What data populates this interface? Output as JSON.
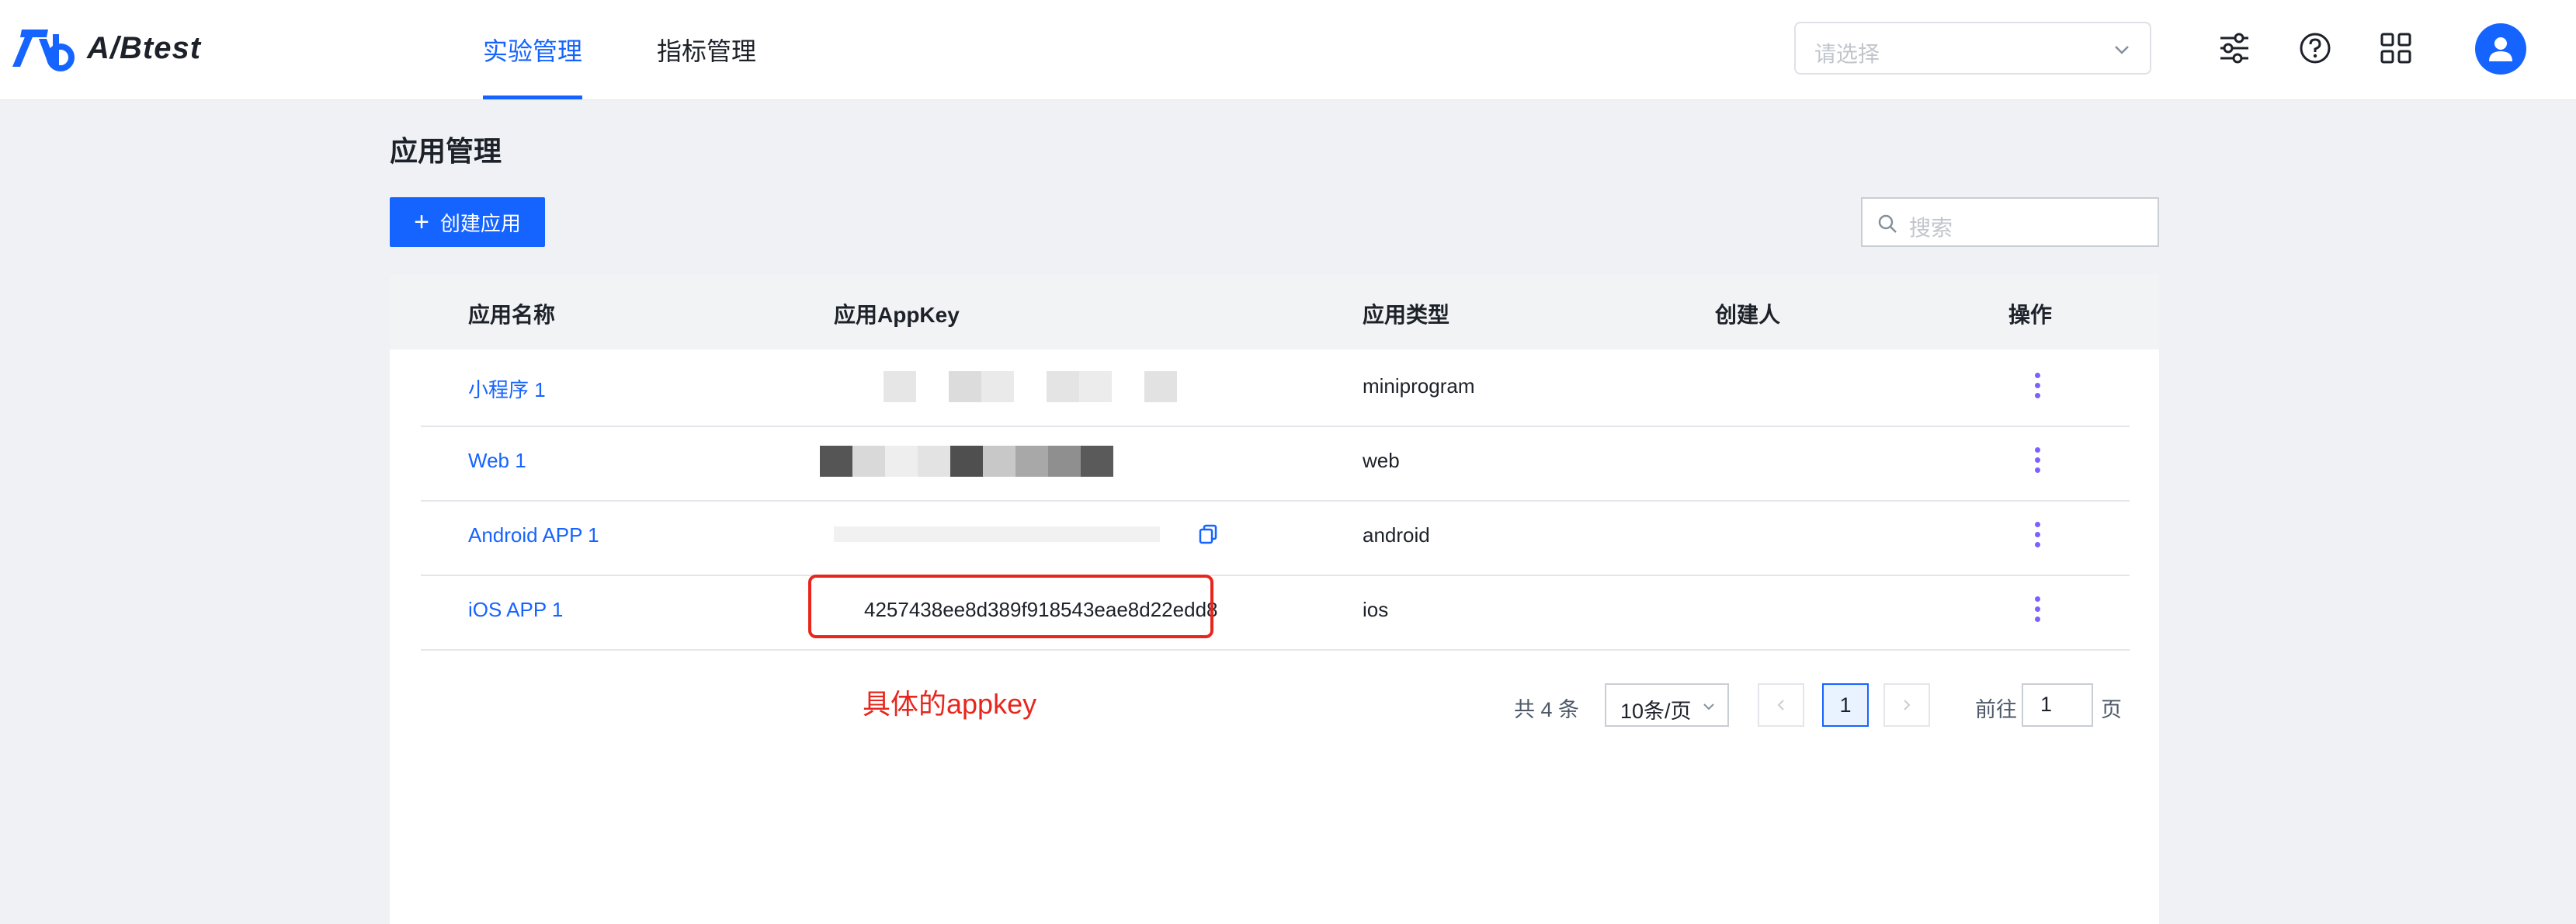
{
  "brand": {
    "name": "A/Btest",
    "accent": "#1664ff"
  },
  "nav": {
    "tabs": [
      {
        "label": "实验管理",
        "active": true
      },
      {
        "label": "指标管理",
        "active": false
      }
    ]
  },
  "header": {
    "app_select_placeholder": "请选择"
  },
  "page": {
    "title": "应用管理",
    "create_button": "创建应用",
    "search_placeholder": "搜索"
  },
  "table": {
    "columns": [
      "应用名称",
      "应用AppKey",
      "应用类型",
      "创建人",
      "操作"
    ],
    "rows": [
      {
        "name": "小程序 1",
        "appkey": "",
        "type": "miniprogram",
        "creator": ""
      },
      {
        "name": "Web 1",
        "appkey": "",
        "type": "web",
        "creator": ""
      },
      {
        "name": "Android APP 1",
        "appkey": "",
        "type": "android",
        "creator": ""
      },
      {
        "name": "iOS APP 1",
        "appkey": "4257438ee8d389f918543eae8d22edd8",
        "type": "ios",
        "creator": ""
      }
    ]
  },
  "annotation": {
    "text": "具体的appkey",
    "color": "#e8261d"
  },
  "pagination": {
    "total_text": "共 4 条",
    "page_size": "10条/页",
    "current_page": "1",
    "goto_label": "前往",
    "goto_value": "1",
    "page_suffix": "页"
  }
}
